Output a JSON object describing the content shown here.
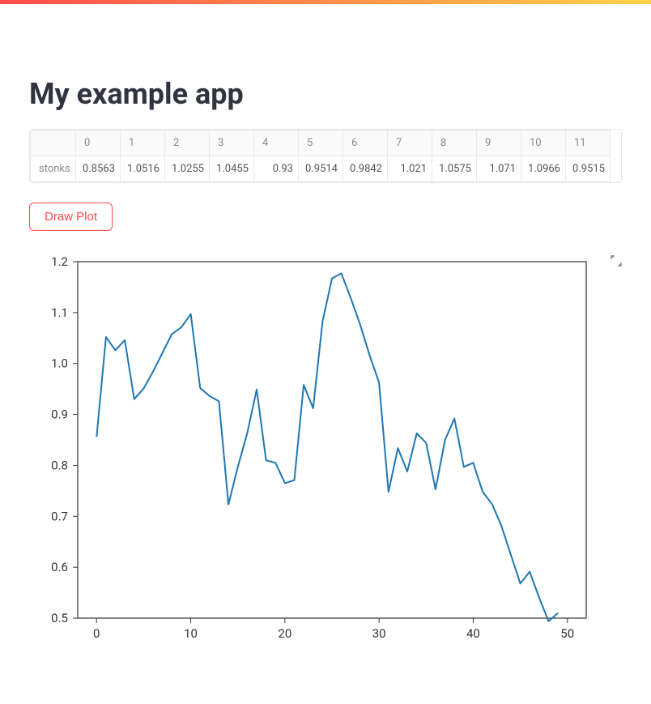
{
  "title": "My example app",
  "table": {
    "row_label": "stonks",
    "columns": [
      "0",
      "1",
      "2",
      "3",
      "4",
      "5",
      "6",
      "7",
      "8",
      "9",
      "10",
      "11"
    ],
    "values": [
      "0.8563",
      "1.0516",
      "1.0255",
      "1.0455",
      "0.93",
      "0.9514",
      "0.9842",
      "1.021",
      "1.0575",
      "1.071",
      "1.0966",
      "0.9515"
    ]
  },
  "button_label": "Draw Plot",
  "chart_data": {
    "type": "line",
    "xlabel": "",
    "ylabel": "",
    "xlim": [
      0,
      50
    ],
    "ylim": [
      0.5,
      1.2
    ],
    "xticks": [
      0,
      10,
      20,
      30,
      40,
      50
    ],
    "yticks": [
      0.5,
      0.6,
      0.7,
      0.8,
      0.9,
      1.0,
      1.1,
      1.2
    ],
    "series": [
      {
        "name": "stonks",
        "x": [
          0,
          1,
          2,
          3,
          4,
          5,
          6,
          7,
          8,
          9,
          10,
          11,
          12,
          13,
          14,
          15,
          16,
          17,
          18,
          19,
          20,
          21,
          22,
          23,
          24,
          25,
          26,
          27,
          28,
          29,
          30,
          31,
          32,
          33,
          34,
          35,
          36,
          37,
          38,
          39,
          40,
          41,
          42,
          43,
          44,
          45,
          46,
          47,
          48,
          49
        ],
        "y": [
          0.856,
          1.052,
          1.026,
          1.046,
          0.93,
          0.951,
          0.984,
          1.021,
          1.058,
          1.071,
          1.097,
          0.952,
          0.936,
          0.926,
          0.723,
          0.797,
          0.863,
          0.949,
          0.81,
          0.805,
          0.765,
          0.771,
          0.958,
          0.912,
          1.083,
          1.167,
          1.177,
          1.128,
          1.076,
          1.016,
          0.963,
          0.748,
          0.834,
          0.788,
          0.863,
          0.844,
          0.753,
          0.85,
          0.892,
          0.797,
          0.805,
          0.748,
          0.724,
          0.681,
          0.624,
          0.568,
          0.591,
          0.54,
          0.494,
          0.51
        ]
      }
    ]
  }
}
